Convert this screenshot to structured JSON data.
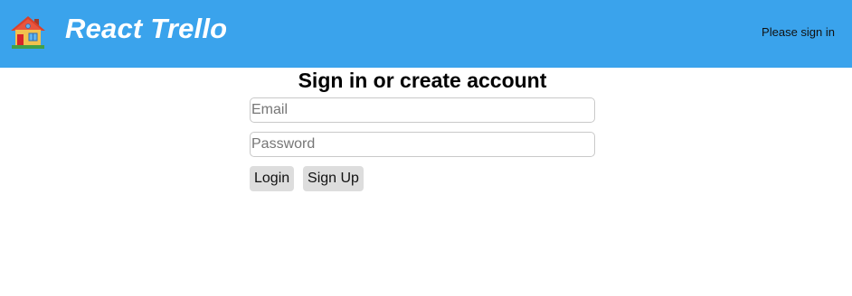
{
  "header": {
    "icon": "house-icon",
    "title": "React Trello",
    "auth_status": "Please sign in",
    "background": "#3aa3ec"
  },
  "signin": {
    "heading": "Sign in or create account",
    "email_placeholder": "Email",
    "email_value": "",
    "password_placeholder": "Password",
    "password_value": "",
    "login_label": "Login",
    "signup_label": "Sign Up"
  }
}
